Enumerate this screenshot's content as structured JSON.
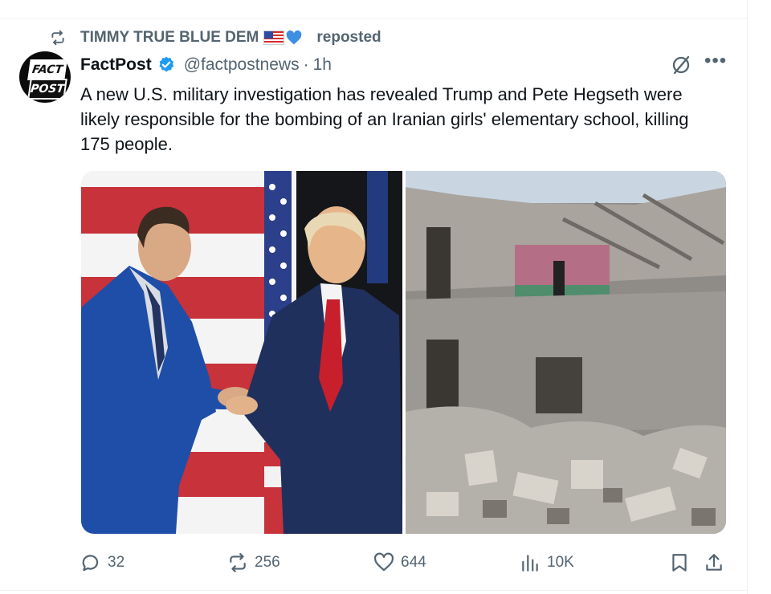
{
  "repost": {
    "user": "TIMMY TRUE BLUE DEM",
    "label": "reposted",
    "icon": "repost-icon",
    "emoji": [
      "us-flag-emoji",
      "blue-heart-emoji"
    ]
  },
  "avatar": {
    "line1": "FACT",
    "line2": "POST"
  },
  "author": {
    "name": "FactPost",
    "handle": "@factpostnews",
    "separator": "·",
    "time": "1h",
    "verified_color": "#1d9bf0"
  },
  "tweet": {
    "text": "A new U.S. military investigation has revealed Trump and Pete Hegseth were likely responsible for the bombing of an Iranian girls' elementary school, killing 175 people."
  },
  "media": {
    "left": "photo of two men in suits shaking hands in front of American flags",
    "right": "photo of a destroyed building and rubble"
  },
  "actions": {
    "reply_count": "32",
    "repost_count": "256",
    "like_count": "644",
    "views_count": "10K"
  },
  "colors": {
    "text": "#0f1419",
    "secondary": "#536471",
    "accent": "#1d9bf0"
  }
}
